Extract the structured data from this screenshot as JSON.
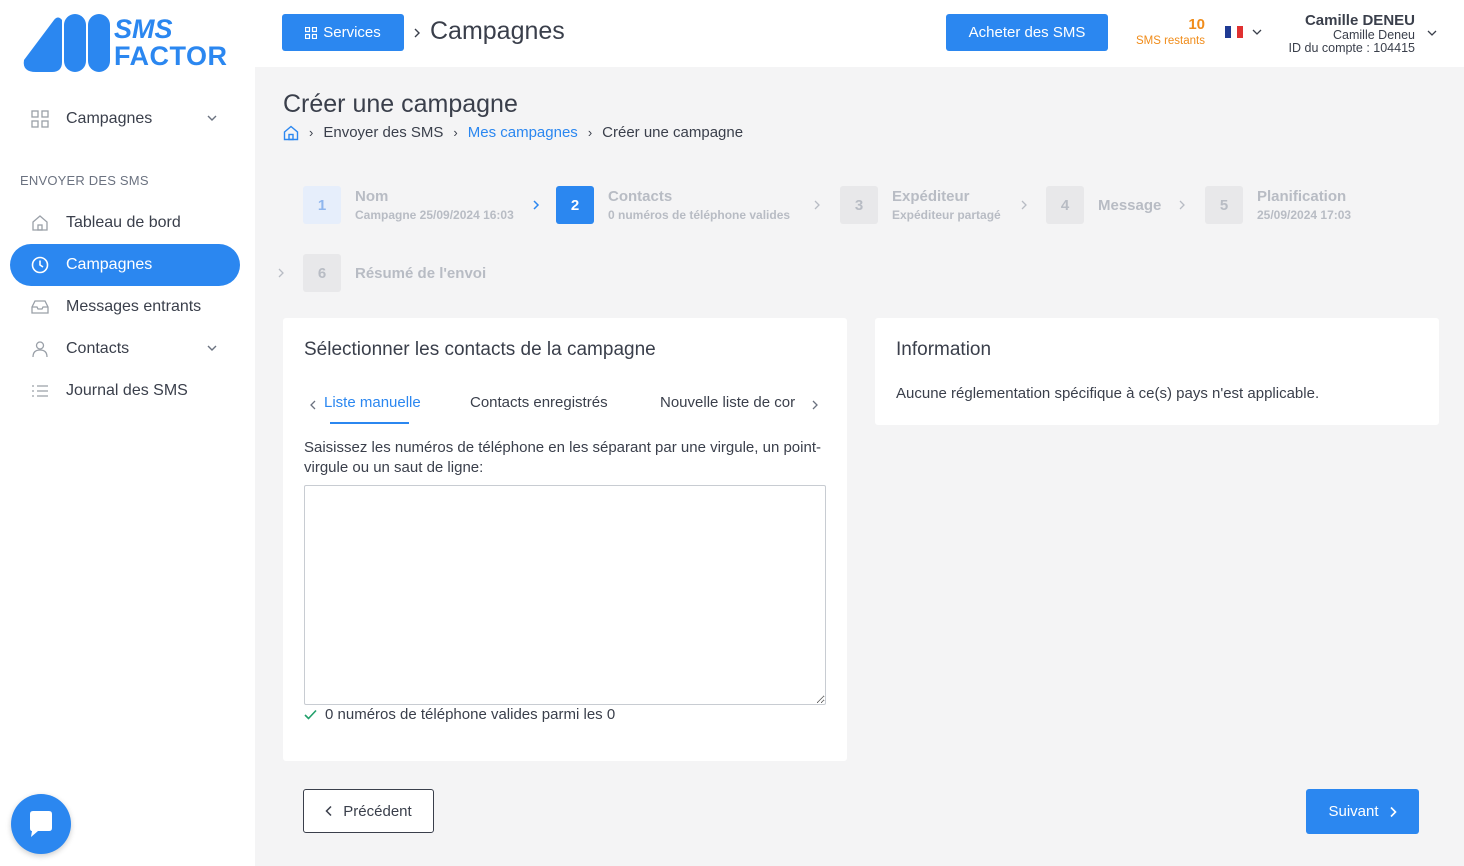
{
  "brand": {
    "line1": "SMS",
    "line2": "FACTOR",
    "color": "#2b87f0"
  },
  "sidebar": {
    "top_item": {
      "label": "Campagnes",
      "icon": "grid-icon"
    },
    "section_title": "ENVOYER DES SMS",
    "items": [
      {
        "label": "Tableau de bord",
        "icon": "home-icon",
        "active": false
      },
      {
        "label": "Campagnes",
        "icon": "clock-icon",
        "active": true
      },
      {
        "label": "Messages entrants",
        "icon": "inbox-icon",
        "active": false
      },
      {
        "label": "Contacts",
        "icon": "user-icon",
        "active": false
      },
      {
        "label": "Journal des SMS",
        "icon": "list-icon",
        "active": false
      }
    ]
  },
  "topbar": {
    "services_label": "Services",
    "title": "Campagnes",
    "buy_label": "Acheter des SMS",
    "sms_count": "10",
    "sms_count_label": "SMS restants",
    "user_name": "Camille DENEU",
    "user_sub": "Camille Deneu",
    "account_id": "ID du compte : 104415"
  },
  "page": {
    "title": "Créer une campagne",
    "breadcrumb": [
      "Envoyer des SMS",
      "Mes campagnes",
      "Créer une campagne"
    ]
  },
  "steps": [
    {
      "num": "1",
      "title": "Nom",
      "sub": "Campagne 25/09/2024 16:03"
    },
    {
      "num": "2",
      "title": "Contacts",
      "sub": "0 numéros de téléphone valides"
    },
    {
      "num": "3",
      "title": "Expéditeur",
      "sub": "Expéditeur partagé"
    },
    {
      "num": "4",
      "title": "Message",
      "sub": ""
    },
    {
      "num": "5",
      "title": "Planification",
      "sub": "25/09/2024 17:03"
    },
    {
      "num": "6",
      "title": "Résumé de l'envoi",
      "sub": ""
    }
  ],
  "contacts_card": {
    "title": "Sélectionner les contacts de la campagne",
    "tabs": [
      "Liste manuelle",
      "Contacts enregistrés",
      "Nouvelle liste de cor"
    ],
    "help": "Saisissez les numéros de téléphone en les séparant par une virgule, un point-virgule ou un saut de ligne:",
    "input_value": "",
    "valid_text": "0 numéros de téléphone valides parmi les 0"
  },
  "info_card": {
    "title": "Information",
    "text": "Aucune réglementation spécifique à ce(s) pays n'est applicable."
  },
  "footer": {
    "prev_label": "Précédent",
    "next_label": "Suivant"
  },
  "colors": {
    "accent": "#2b87f0",
    "warning": "#f08c1a"
  }
}
